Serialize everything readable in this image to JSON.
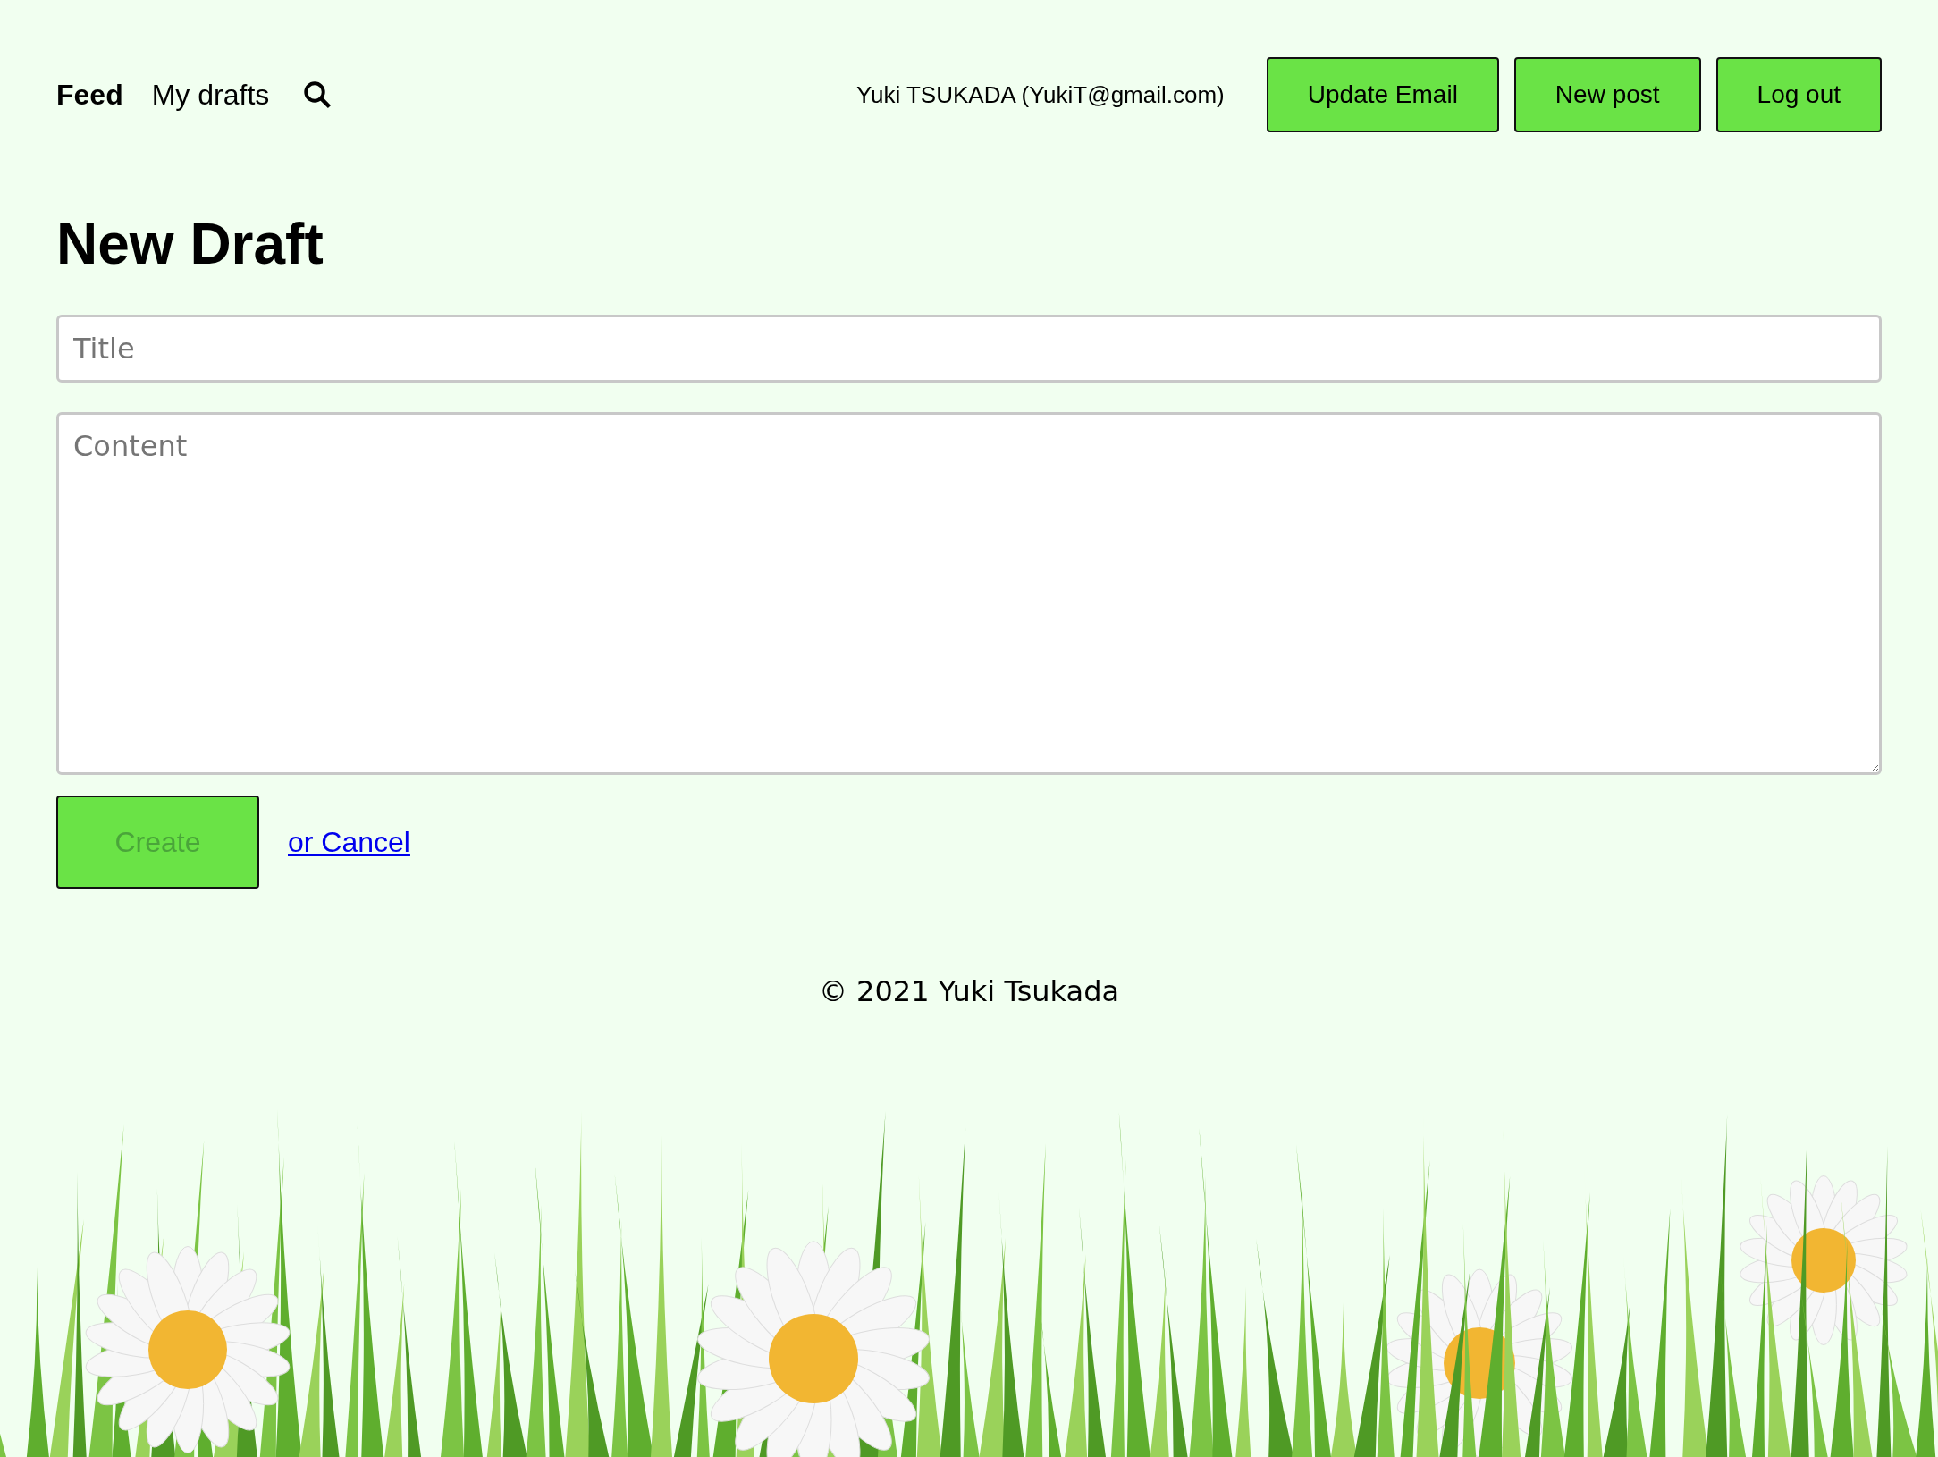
{
  "nav": {
    "items": [
      {
        "label": "Feed",
        "selected": true
      },
      {
        "label": "My drafts",
        "selected": false
      }
    ]
  },
  "user": "Yuki TSUKADA (YukiT@gmail.com)",
  "actions": [
    "Update Email",
    "New post",
    "Log out"
  ],
  "heading": "New Draft",
  "form": {
    "title": {
      "placeholder": "Title"
    },
    "content": {
      "placeholder": "Content"
    },
    "submit": {
      "label": "Create",
      "disabled": true
    },
    "cancel": "or Cancel"
  },
  "footer": "© 2021 Yuki Tsukada"
}
